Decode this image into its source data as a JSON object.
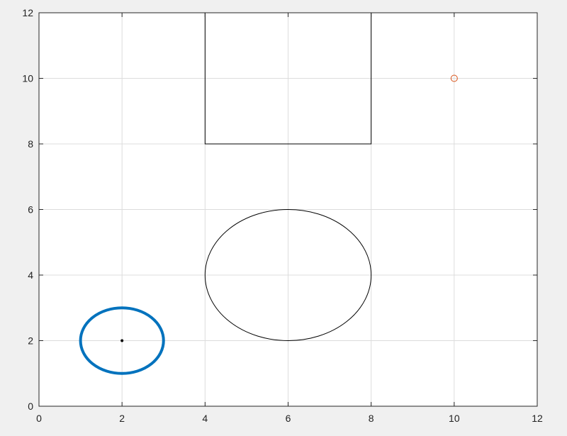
{
  "chart_data": {
    "type": "scatter",
    "title": "",
    "xlabel": "",
    "ylabel": "",
    "xlim": [
      0,
      12
    ],
    "ylim": [
      0,
      12
    ],
    "grid": true,
    "x_ticks": [
      "0",
      "2",
      "4",
      "6",
      "8",
      "10",
      "12"
    ],
    "y_ticks": [
      "0",
      "2",
      "4",
      "6",
      "8",
      "10",
      "12"
    ],
    "shapes": [
      {
        "kind": "rectangle",
        "x": 4,
        "y": 8,
        "width": 4,
        "height": 4,
        "color": "#000000",
        "line": "thin"
      },
      {
        "kind": "ellipse",
        "cx": 6,
        "cy": 4,
        "rx": 2,
        "ry": 2,
        "color": "#000000",
        "line": "thin"
      },
      {
        "kind": "ellipse",
        "cx": 2,
        "cy": 2,
        "rx": 1,
        "ry": 1,
        "color": "#0072BD",
        "line": "thick"
      }
    ],
    "points": [
      {
        "x": 2,
        "y": 2,
        "marker": "dot",
        "color": "#000000"
      },
      {
        "x": 10,
        "y": 10,
        "marker": "circle",
        "color": "#D95319"
      }
    ]
  }
}
